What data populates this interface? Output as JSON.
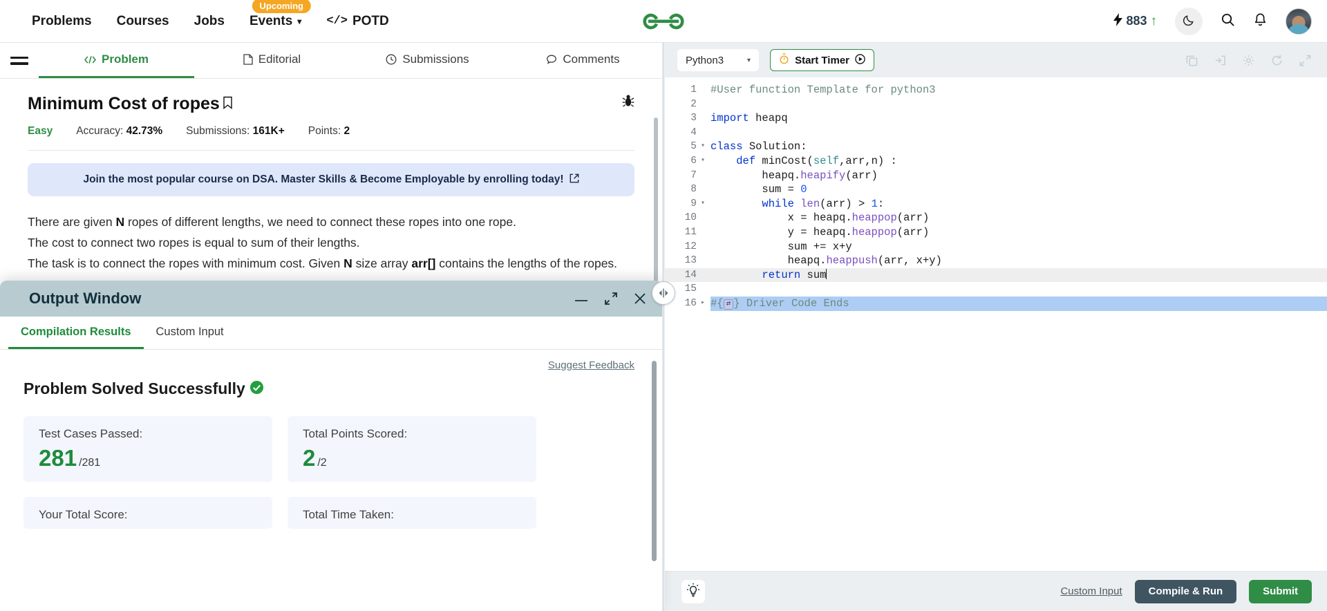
{
  "topnav": {
    "links": [
      {
        "label": "Problems",
        "badge": null,
        "caret": false
      },
      {
        "label": "Courses",
        "badge": null,
        "caret": false
      },
      {
        "label": "Jobs",
        "badge": null,
        "caret": false
      },
      {
        "label": "Events",
        "badge": "Upcoming",
        "caret": true
      }
    ],
    "potd_label": "POTD",
    "potd_icon": "</>",
    "logo_alt": "geeksforgeeks-logo",
    "streak": {
      "icon": "lightning-icon",
      "count": "883",
      "trend": "↑"
    },
    "theme_icon": "moon-icon",
    "search_icon": "search-icon",
    "bell_icon": "notification-bell-icon",
    "avatar_alt": "user-avatar"
  },
  "problem_tabs": [
    {
      "label": "Problem",
      "icon": "code-icon",
      "active": true
    },
    {
      "label": "Editorial",
      "icon": "document-icon",
      "active": false
    },
    {
      "label": "Submissions",
      "icon": "clock-icon",
      "active": false
    },
    {
      "label": "Comments",
      "icon": "comment-icon",
      "active": false
    }
  ],
  "problem": {
    "title": "Minimum Cost of ropes",
    "bookmark_icon": "bookmark-icon",
    "report_icon": "bug-report-icon",
    "difficulty": "Easy",
    "accuracy_label": "Accuracy:",
    "accuracy_value": "42.73%",
    "submissions_label": "Submissions:",
    "submissions_value": "161K+",
    "points_label": "Points:",
    "points_value": "2",
    "promo_text": "Join the most popular course on DSA. Master Skills & Become Employable by enrolling today!",
    "promo_icon": "external-link-icon",
    "description": [
      {
        "pre": "There are given ",
        "bold": "N",
        "post": " ropes of different lengths, we need to connect these ropes into one rope."
      },
      {
        "pre": "The cost to connect two ropes is equal to sum of their lengths.",
        "bold": "",
        "post": ""
      },
      {
        "pre": "The task is to connect the ropes with minimum cost. Given ",
        "bold": "N",
        "post": " size array ",
        "bold2": "arr[]",
        "post2": " contains the lengths of the ropes."
      }
    ]
  },
  "output_window": {
    "title": "Output Window",
    "minimize_icon": "minimize-icon",
    "expand_icon": "expand-icon",
    "close_icon": "close-icon",
    "tabs": [
      {
        "label": "Compilation Results",
        "active": true
      },
      {
        "label": "Custom Input",
        "active": false
      }
    ],
    "suggest_feedback": "Suggest Feedback",
    "status_text": "Problem Solved Successfully",
    "status_icon": "success-check-icon",
    "cards": [
      {
        "label": "Test Cases Passed:",
        "value": "281",
        "suffix": "/281"
      },
      {
        "label": "Total Points Scored:",
        "value": "2",
        "suffix": "/2"
      },
      {
        "label": "Your Total Score:",
        "value": "",
        "suffix": ""
      },
      {
        "label": "Total Time Taken:",
        "value": "",
        "suffix": ""
      }
    ]
  },
  "splitter": {
    "handle_icon": "collapse-expand-handle"
  },
  "editor": {
    "language": "Python3",
    "language_caret": "▾",
    "timer_label": "Start Timer",
    "timer_icon": "stopwatch-icon",
    "timer_play_icon": "play-circle-icon",
    "tool_icons": [
      "copy-icon",
      "import-file-icon",
      "settings-gear-icon",
      "reset-code-icon",
      "fullscreen-icon"
    ],
    "bulb_icon": "hint-bulb-icon",
    "custom_input_link": "Custom Input",
    "compile_run_label": "Compile & Run",
    "submit_label": "Submit",
    "code_lines": [
      {
        "n": "1",
        "fold": "",
        "hl": false,
        "sel": false,
        "tokens": [
          {
            "t": "cmt",
            "v": "#User function Template for python3"
          }
        ]
      },
      {
        "n": "2",
        "fold": "",
        "hl": false,
        "sel": false,
        "tokens": []
      },
      {
        "n": "3",
        "fold": "",
        "hl": false,
        "sel": false,
        "tokens": [
          {
            "t": "kw",
            "v": "import"
          },
          {
            "t": "txt",
            "v": " heapq"
          }
        ]
      },
      {
        "n": "4",
        "fold": "",
        "hl": false,
        "sel": false,
        "tokens": []
      },
      {
        "n": "5",
        "fold": "▾",
        "hl": false,
        "sel": false,
        "tokens": [
          {
            "t": "kw",
            "v": "class"
          },
          {
            "t": "txt",
            "v": " Solution:"
          }
        ]
      },
      {
        "n": "6",
        "fold": "▾",
        "hl": false,
        "sel": false,
        "tokens": [
          {
            "t": "txt",
            "v": "    "
          },
          {
            "t": "kw",
            "v": "def"
          },
          {
            "t": "txt",
            "v": " minCost("
          },
          {
            "t": "self",
            "v": "self"
          },
          {
            "t": "txt",
            "v": ",arr,n) :"
          }
        ]
      },
      {
        "n": "7",
        "fold": "",
        "hl": false,
        "sel": false,
        "tokens": [
          {
            "t": "txt",
            "v": "        heapq."
          },
          {
            "t": "fn",
            "v": "heapify"
          },
          {
            "t": "txt",
            "v": "(arr)"
          }
        ]
      },
      {
        "n": "8",
        "fold": "",
        "hl": false,
        "sel": false,
        "tokens": [
          {
            "t": "txt",
            "v": "        sum = "
          },
          {
            "t": "num",
            "v": "0"
          }
        ]
      },
      {
        "n": "9",
        "fold": "▾",
        "hl": false,
        "sel": false,
        "tokens": [
          {
            "t": "txt",
            "v": "        "
          },
          {
            "t": "kw",
            "v": "while"
          },
          {
            "t": "txt",
            "v": " "
          },
          {
            "t": "fn",
            "v": "len"
          },
          {
            "t": "txt",
            "v": "(arr) > "
          },
          {
            "t": "num",
            "v": "1"
          },
          {
            "t": "txt",
            "v": ":"
          }
        ]
      },
      {
        "n": "10",
        "fold": "",
        "hl": false,
        "sel": false,
        "tokens": [
          {
            "t": "txt",
            "v": "            x = heapq."
          },
          {
            "t": "fn",
            "v": "heappop"
          },
          {
            "t": "txt",
            "v": "(arr)"
          }
        ]
      },
      {
        "n": "11",
        "fold": "",
        "hl": false,
        "sel": false,
        "tokens": [
          {
            "t": "txt",
            "v": "            y = heapq."
          },
          {
            "t": "fn",
            "v": "heappop"
          },
          {
            "t": "txt",
            "v": "(arr)"
          }
        ]
      },
      {
        "n": "12",
        "fold": "",
        "hl": false,
        "sel": false,
        "tokens": [
          {
            "t": "txt",
            "v": "            sum += x+y"
          }
        ]
      },
      {
        "n": "13",
        "fold": "",
        "hl": false,
        "sel": false,
        "tokens": [
          {
            "t": "txt",
            "v": "            heapq."
          },
          {
            "t": "fn",
            "v": "heappush"
          },
          {
            "t": "txt",
            "v": "(arr, x+y)"
          }
        ]
      },
      {
        "n": "14",
        "fold": "",
        "hl": true,
        "sel": false,
        "caret": true,
        "tokens": [
          {
            "t": "txt",
            "v": "        "
          },
          {
            "t": "kw",
            "v": "return"
          },
          {
            "t": "txt",
            "v": " sum"
          }
        ]
      },
      {
        "n": "15",
        "fold": "",
        "hl": false,
        "sel": false,
        "tokens": []
      },
      {
        "n": "16",
        "fold": "▸",
        "hl": false,
        "sel": true,
        "chip": true,
        "tokens": [
          {
            "t": "cmt",
            "v": "#{"
          },
          {
            "t": "chip",
            "v": "⇄"
          },
          {
            "t": "cmt",
            "v": "} Driver Code Ends"
          }
        ]
      }
    ]
  },
  "colors": {
    "brand_green": "#2f8d46",
    "accent_orange": "#f5a623",
    "promo_bg": "#dfe7fa",
    "outwin_header": "#b8cbd0",
    "compile_btn": "#3f5662"
  }
}
